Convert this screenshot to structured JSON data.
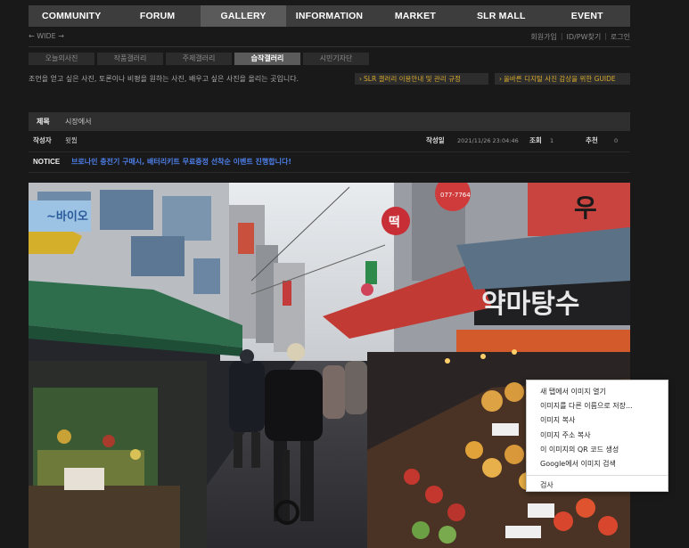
{
  "nav": {
    "items": [
      {
        "label": "COMMUNITY",
        "active": false
      },
      {
        "label": "FORUM",
        "active": false
      },
      {
        "label": "GALLERY",
        "active": true
      },
      {
        "label": "INFORMATION",
        "active": false
      },
      {
        "label": "MARKET",
        "active": false
      },
      {
        "label": "SLR MALL",
        "active": false
      },
      {
        "label": "EVENT",
        "active": false
      }
    ]
  },
  "subbar": {
    "wide": "← WIDE →",
    "signup": "회원가입",
    "find": "ID/PW찾기",
    "login": "로그인"
  },
  "gallery_tabs": [
    {
      "label": "오늘의사진",
      "active": false
    },
    {
      "label": "작품갤러리",
      "active": false
    },
    {
      "label": "주제갤러리",
      "active": false
    },
    {
      "label": "습작갤러리",
      "active": true
    },
    {
      "label": "시민기자단",
      "active": false
    }
  ],
  "description": "조언을 얻고 싶은 사진, 토론이나 비평을 원하는 사진, 배우고 싶은 사진을 올리는 곳입니다.",
  "guides": {
    "rules": "SLR 갤러리 이용안내 및 관리 규정",
    "guide": "올바른 디지털 사진 감상을 위한 GUIDE"
  },
  "post": {
    "title_label": "제목",
    "title": "시장에서",
    "author_label": "작성자",
    "author": "윗뭡",
    "date_label": "작성일",
    "date": "2021/11/26 23:04:46",
    "views_label": "조회",
    "views": "1",
    "recommend_label": "추천",
    "recommend": "0"
  },
  "notice": {
    "label": "NOTICE",
    "text": "브로나인 충전기 구매시, 배터리키트 무료증정 선착순 이벤트 진행합니다!"
  },
  "photo_signs": {
    "top_left": "~바이오",
    "phone": "077-7764",
    "round_sign": "떡",
    "shop": "약마탕수",
    "top_right": "우"
  },
  "context_menu": {
    "items": [
      "새 탭에서 이미지 열기",
      "이미지를 다른 이름으로 저장...",
      "이미지 복사",
      "이미지 주소 복사",
      "이 이미지의 QR 코드 생성",
      "Google에서 이미지 검색"
    ],
    "inspect": "검사"
  },
  "colors": {
    "accent_gold": "#d6a92c",
    "notice_blue": "#4d7ee8",
    "nav_bg": "#3d3d3d"
  }
}
